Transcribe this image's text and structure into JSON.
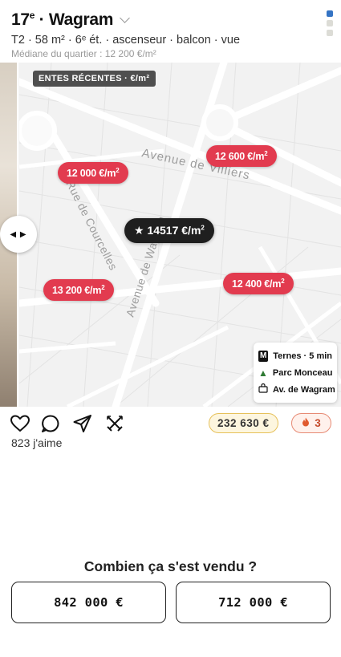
{
  "header": {
    "arrondissement": "17",
    "ordinal_suffix": "e",
    "title_rest": " · Wagram",
    "meta": "T2 · 58 m² · 6ᵉ ét. · ascenseur · balcon · vue",
    "median": "Médiane du quartier : 12 200 €/m²",
    "page_dots": {
      "count": 3,
      "active_index": 0,
      "active_color": "#3574c4"
    }
  },
  "map": {
    "section_label": "ENTES RÉCENTES · €/m²",
    "streets": [
      {
        "name": "Avenue de Villiers"
      },
      {
        "name": "Rue de Courcelles"
      },
      {
        "name": "Avenue de Wagram"
      }
    ],
    "sales": [
      {
        "id": "s1",
        "value": "12 000 €/m",
        "sup": "2"
      },
      {
        "id": "s2",
        "value": "12 600 €/m",
        "sup": "2"
      },
      {
        "id": "s3",
        "value": "13 200 €/m",
        "sup": "2"
      },
      {
        "id": "s4",
        "value": "12 400 €/m",
        "sup": "2"
      }
    ],
    "subject": {
      "value": "14517 €/m",
      "sup": "2",
      "icon": "star-icon"
    },
    "legend": {
      "metro_badge": "M",
      "metro": "Ternes · 5 min",
      "park": "Parc Monceau",
      "shop": "Av. de Wagram"
    },
    "handle_glyph": "◀ ▶",
    "pin_color": "#e23b4f"
  },
  "actions": {
    "price": "232 630 €",
    "streak": "3",
    "likes": "823 j'aime"
  },
  "quiz": {
    "question": "Combien ça s'est vendu ?",
    "options": [
      "842 000 €",
      "712 000 €"
    ]
  }
}
